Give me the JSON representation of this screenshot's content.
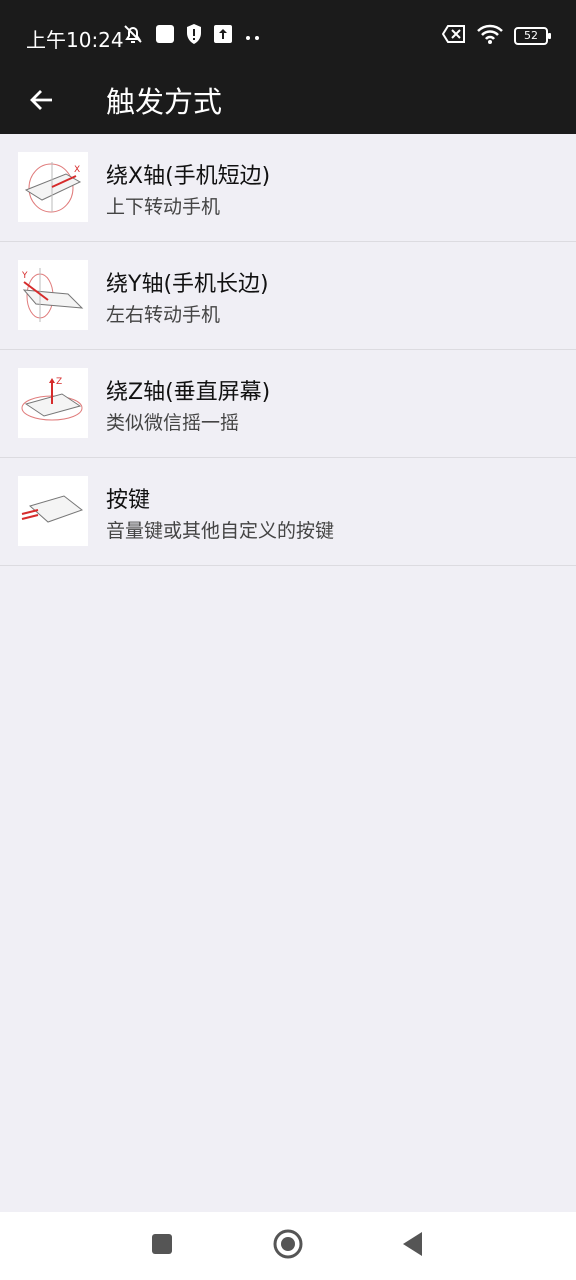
{
  "status_bar": {
    "time": "上午10:24",
    "battery_level": "52",
    "icons": [
      "mute-notification-icon",
      "square-app-icon",
      "shield-icon",
      "upload-icon",
      "more-dots-icon",
      "sim-x-icon",
      "wifi-icon",
      "battery-icon"
    ]
  },
  "app_bar": {
    "title": "触发方式",
    "back_icon": "back-arrow-icon"
  },
  "items": [
    {
      "title": "绕X轴(手机短边)",
      "subtitle": "上下转动手机",
      "icon": "x-axis-rotation-icon"
    },
    {
      "title": "绕Y轴(手机长边)",
      "subtitle": "左右转动手机",
      "icon": "y-axis-rotation-icon"
    },
    {
      "title": "绕Z轴(垂直屏幕)",
      "subtitle": "类似微信摇一摇",
      "icon": "z-axis-rotation-icon"
    },
    {
      "title": "按键",
      "subtitle": "音量键或其他自定义的按键",
      "icon": "key-press-icon"
    }
  ],
  "axis_labels": {
    "x": "X",
    "y": "Y",
    "z": "Z"
  },
  "nav_bar": {
    "icons": [
      "recents-square-icon",
      "home-circle-icon",
      "back-triangle-icon"
    ]
  },
  "colors": {
    "bar_bg": "#1b1b1b",
    "page_bg": "#f0eff5",
    "accent_red": "#d62b2b"
  }
}
